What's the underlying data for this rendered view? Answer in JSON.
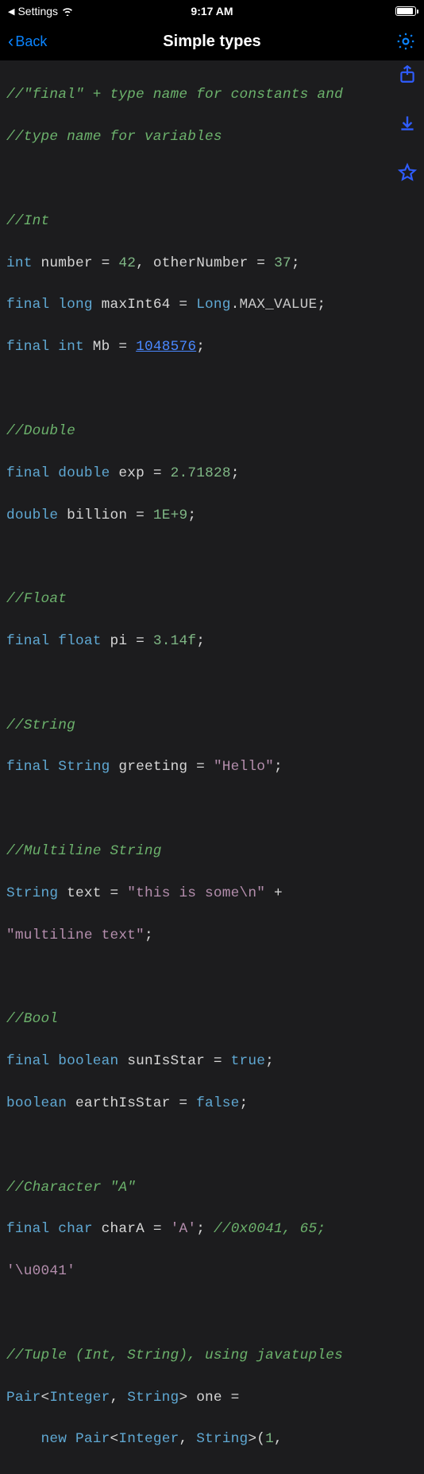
{
  "status": {
    "source_app": "Settings",
    "time": "9:17 AM"
  },
  "nav": {
    "back": "Back",
    "title": "Simple types"
  },
  "code": {
    "c1": "//\"final\" + type name for constants and",
    "c2": "//type name for variables",
    "c_int": "//Int",
    "kw_int": "int",
    "id_number": "number",
    "eq": " = ",
    "n42": "42",
    "comma": ", ",
    "id_otherNumber": "otherNumber",
    "n37": "37",
    "semi": ";",
    "kw_final": "final",
    "kw_long": "long",
    "id_maxInt64": "maxInt64",
    "cls_Long": "Long",
    "dot": ".",
    "const_max": "MAX_VALUE",
    "id_Mb": "Mb",
    "n_mb": "1048576",
    "c_double": "//Double",
    "kw_double": "double",
    "id_exp": "exp",
    "n_exp": "2.71828",
    "id_billion": "billion",
    "n_billion": "1E+9",
    "c_float": "//Float",
    "kw_float": "float",
    "id_pi": "pi",
    "n_pi": "3.14f",
    "c_string": "//String",
    "cls_String": "String",
    "id_greeting": "greeting",
    "str_hello": "\"Hello\"",
    "c_mstr": "//Multiline String",
    "id_text": "text",
    "str_ms1": "\"this is some\\n\"",
    "plus": " +",
    "str_ms2": "\"multiline text\"",
    "c_bool": "//Bool",
    "kw_boolean": "boolean",
    "id_sunIsStar": "sunIsStar",
    "kw_true": "true",
    "id_earthIsStar": "earthIsStar",
    "kw_false": "false",
    "c_char": "//Character \"A\"",
    "kw_char": "char",
    "id_charA": "charA",
    "ch_A": "'A'",
    "c_char_tail": " //0x0041, 65;",
    "ch_u": "'\\u0041'",
    "c_tuple": "//Tuple (Int, String), using javatuples",
    "cls_Pair": "Pair",
    "lt": "<",
    "gt": ">",
    "cls_Integer": "Integer",
    "comma_s": ", ",
    "id_one": "one",
    "kw_new": "new",
    "paren_open": "(",
    "n1": "1",
    "comma_only": ","
  }
}
